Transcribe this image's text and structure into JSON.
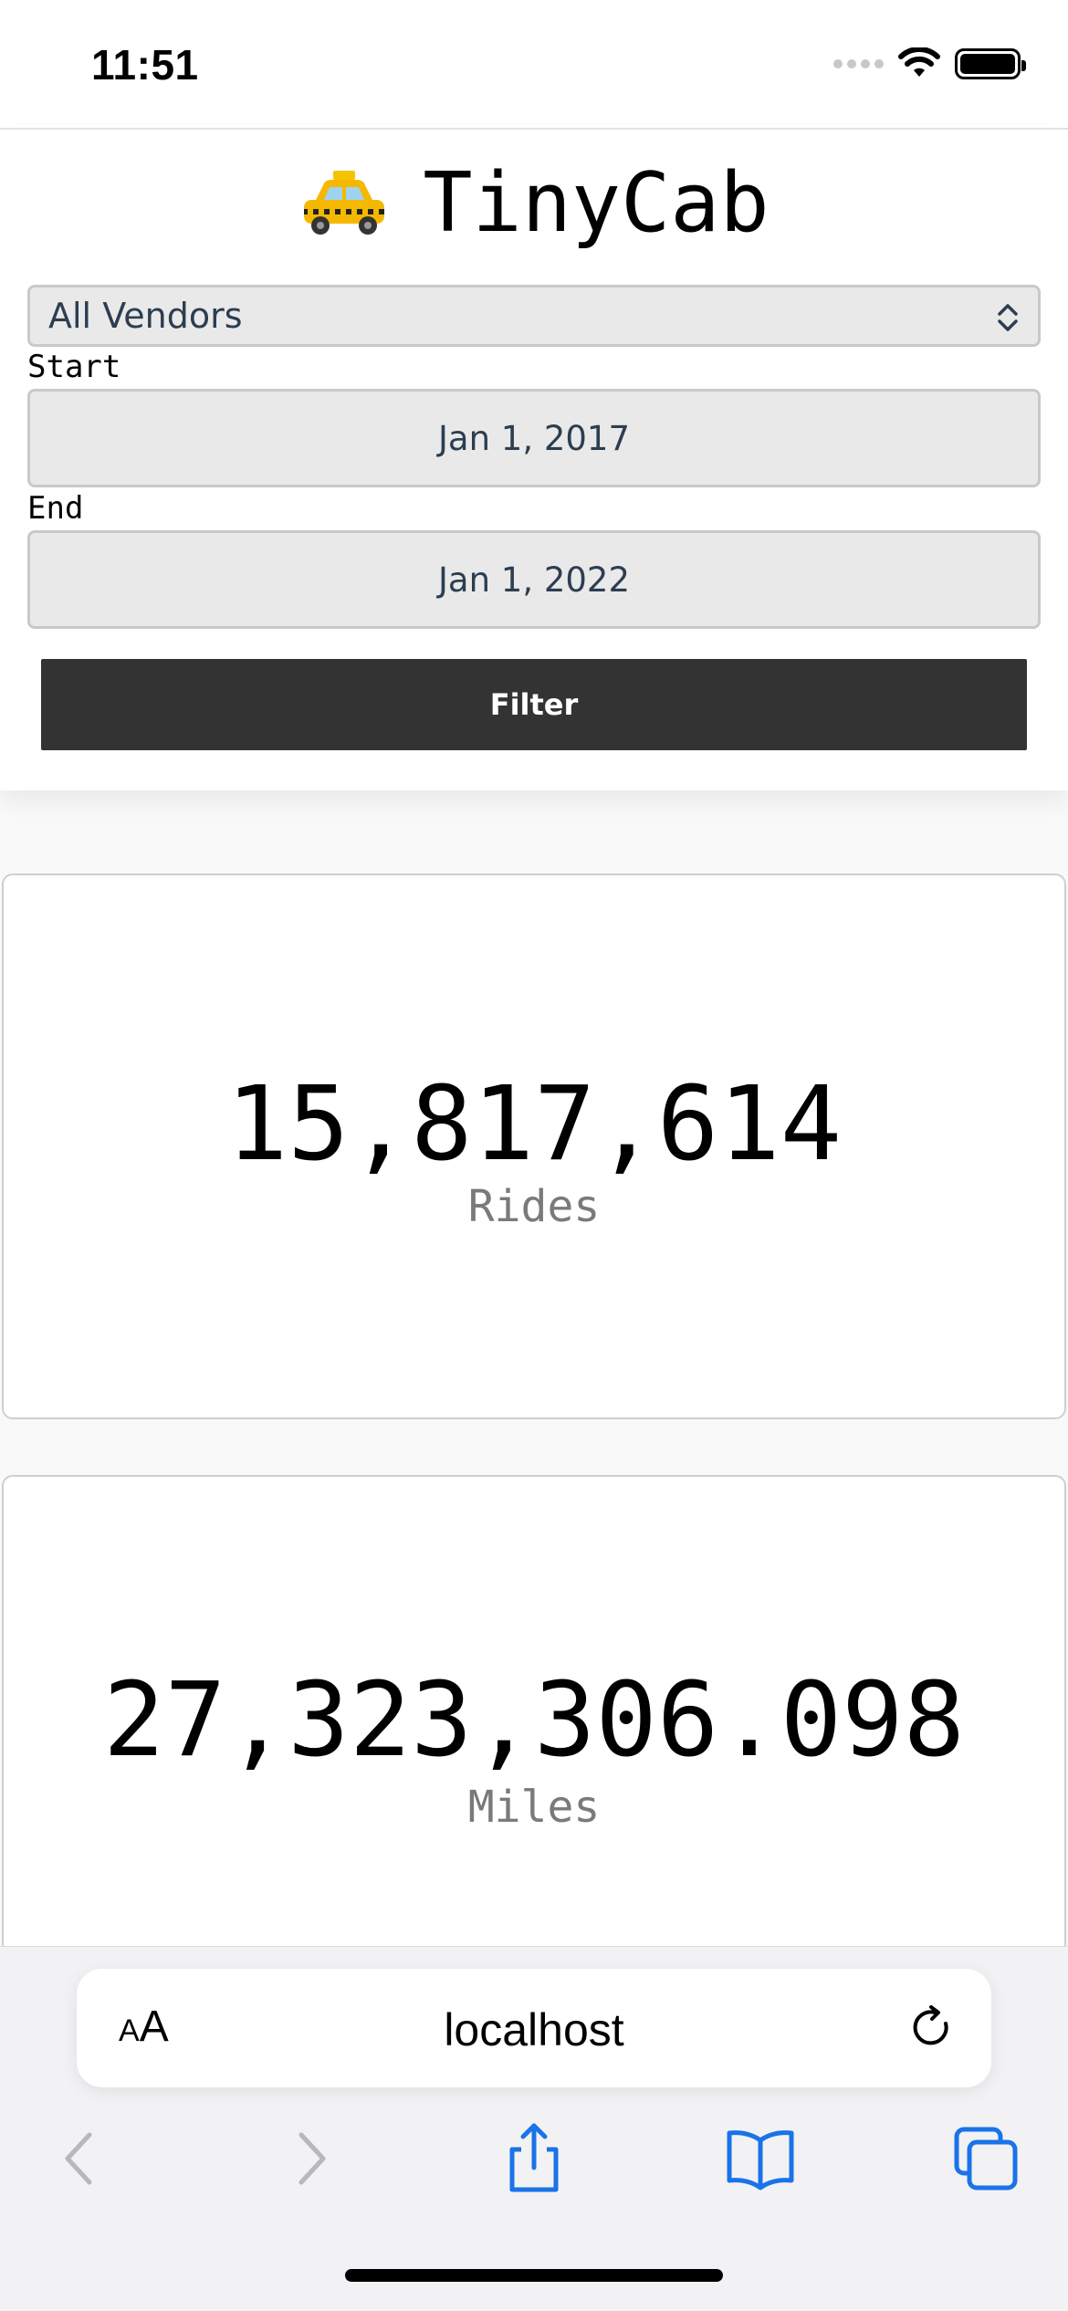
{
  "status_bar": {
    "time": "11:51"
  },
  "header": {
    "app_title": "TinyCab",
    "vendor_select": {
      "value": "All Vendors"
    },
    "start": {
      "label": "Start",
      "value": "Jan 1, 2017"
    },
    "end": {
      "label": "End",
      "value": "Jan 1, 2022"
    },
    "filter_label": "Filter"
  },
  "stats": [
    {
      "value": "15,817,614",
      "label": "Rides"
    },
    {
      "value": "27,323,306.098",
      "label": "Miles"
    }
  ],
  "browser": {
    "text_size_small": "A",
    "text_size_large": "A",
    "url": "localhost"
  },
  "colors": {
    "button_bg": "#333333",
    "input_bg": "#e9e9e9",
    "toolbar_icon": "#1a73e8"
  }
}
